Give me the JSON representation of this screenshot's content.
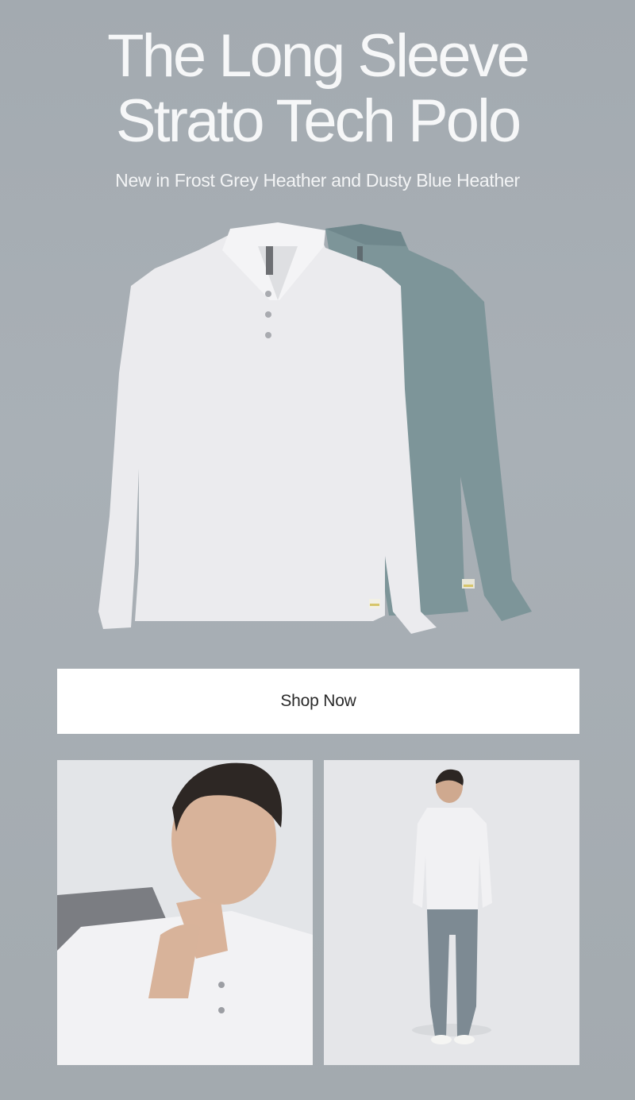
{
  "headline": {
    "line1": "The Long Sleeve",
    "line2": "Strato Tech Polo"
  },
  "subhead": "New in Frost Grey Heather and Dusty Blue Heather",
  "hero": {
    "products": [
      "Frost Grey Heather polo",
      "Dusty Blue Heather polo"
    ],
    "colors": {
      "frost_grey": "#ebebee",
      "dusty_blue": "#7d9599"
    }
  },
  "cta": {
    "label": "Shop Now"
  },
  "colors": {
    "background": "#a6adb3",
    "headline": "#f6f7f8",
    "button_bg": "#ffffff",
    "button_text": "#2a2a2a"
  }
}
